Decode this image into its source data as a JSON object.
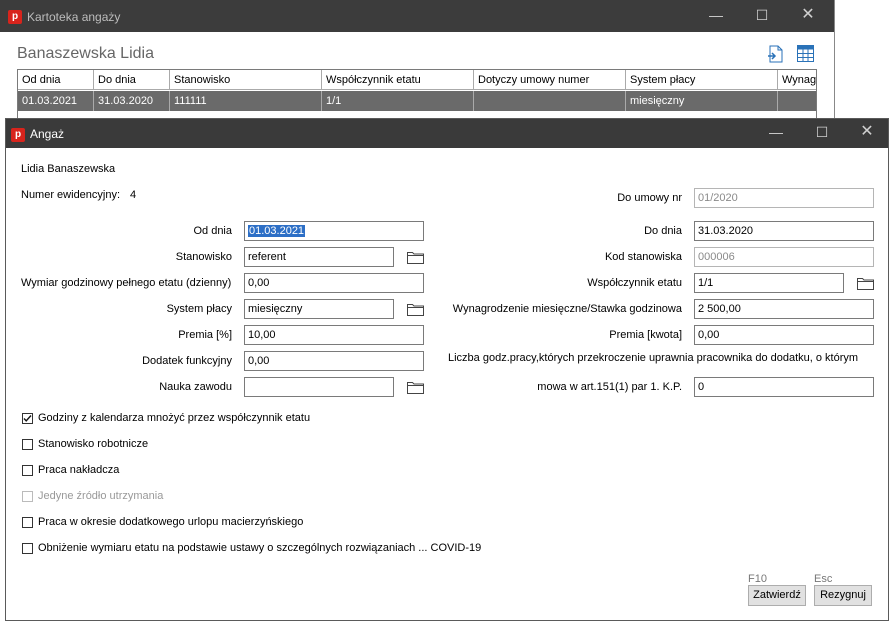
{
  "bg_window": {
    "title": "Kartoteka angaży",
    "heading": "Banaszewska Lidia",
    "columns": [
      "Od dnia",
      "Do dnia",
      "Stanowisko",
      "Współczynnik etatu",
      "Dotyczy umowy numer",
      "System płacy",
      "Wynag"
    ],
    "row": [
      "01.03.2021",
      "31.03.2020",
      "111111",
      "1/1",
      "",
      "miesięczny",
      ""
    ]
  },
  "dialog": {
    "title": "Angaż",
    "employee_name": "Lidia Banaszewska",
    "numer_label": "Numer ewidencyjny:",
    "numer_value": "4",
    "do_umowy_label": "Do umowy nr",
    "do_umowy_value": "01/2020",
    "od_dnia_label": "Od dnia",
    "od_dnia_value": "01.03.2021",
    "do_dnia_label": "Do dnia",
    "do_dnia_value": "31.03.2020",
    "stanowisko_label": "Stanowisko",
    "stanowisko_value": "referent",
    "kod_label": "Kod stanowiska",
    "kod_value": "000006",
    "wymiar_label": "Wymiar godzinowy pełnego etatu (dzienny)",
    "wymiar_value": "0,00",
    "wspolczynnik_label": "Współczynnik etatu",
    "wspolczynnik_value": "1/1",
    "system_label": "System płacy",
    "system_value": "miesięczny",
    "wynagrodzenie_label": "Wynagrodzenie miesięczne/Stawka godzinowa",
    "wynagrodzenie_value": "2 500,00",
    "premia_pct_label": "Premia [%]",
    "premia_pct_value": "10,00",
    "premia_kwota_label": "Premia [kwota]",
    "premia_kwota_value": "0,00",
    "dodatek_label": "Dodatek funkcyjny",
    "dodatek_value": "0,00",
    "liczba_label": "Liczba godz.pracy,których przekroczenie uprawnia pracownika do dodatku, o którym",
    "nauka_label": "Nauka zawodu",
    "nauka_value": "",
    "mowa_label": "mowa w art.151(1) par 1. K.P.",
    "mowa_value": "0",
    "checkboxes": [
      {
        "label": "Godziny z kalendarza mnożyć przez współczynnik etatu",
        "checked": true,
        "disabled": false
      },
      {
        "label": "Stanowisko robotnicze",
        "checked": false,
        "disabled": false
      },
      {
        "label": "Praca nakładcza",
        "checked": false,
        "disabled": false
      },
      {
        "label": "Jedyne źródło utrzymania",
        "checked": false,
        "disabled": true
      },
      {
        "label": "Praca w okresie dodatkowego urlopu macierzyńskiego",
        "checked": false,
        "disabled": false
      },
      {
        "label": "Obniżenie wymiaru etatu na podstawie ustawy o szczególnych rozwiązaniach ... COVID-19",
        "checked": false,
        "disabled": false
      }
    ],
    "confirm_hint": "F10",
    "confirm_label": "Zatwierdź",
    "cancel_hint": "Esc",
    "cancel_label": "Rezygnuj"
  },
  "icons": {
    "app": "app-logo-icon",
    "export": "export-icon",
    "grid": "table-grid-icon",
    "folder": "folder-icon",
    "minimize": "minimize-icon",
    "maximize": "maximize-icon",
    "close": "close-icon"
  },
  "colors": {
    "titlebar": "#3a3a3a",
    "selected_row": "#6a6a6a",
    "selection_highlight": "#2d6fc6",
    "app_logo": "#d8241c"
  }
}
